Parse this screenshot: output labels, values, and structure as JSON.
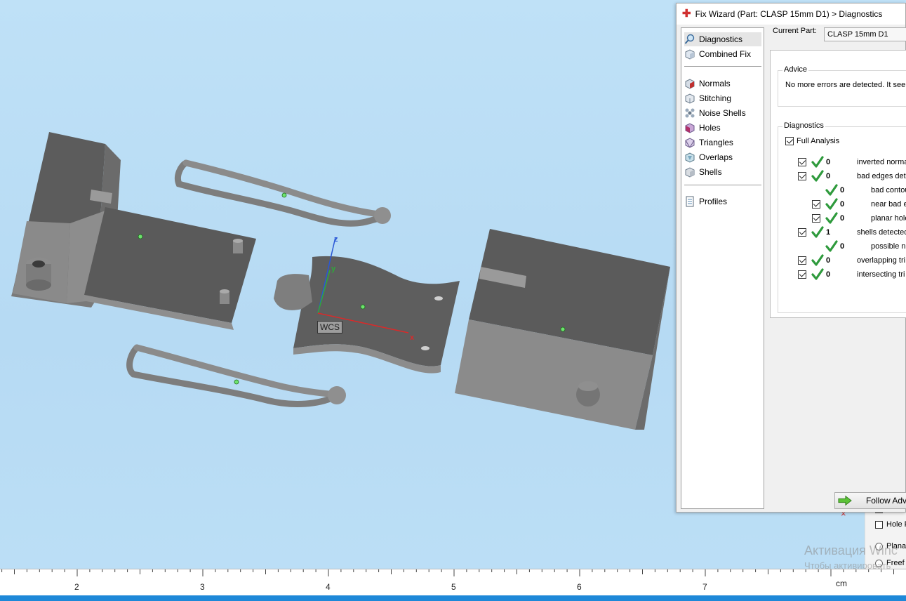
{
  "wizard": {
    "title": "Fix Wizard (Part: CLASP 15mm D1) > Diagnostics",
    "nav": [
      {
        "label": "Diagnostics",
        "icon": "magnifier-icon",
        "selected": true
      },
      {
        "label": "Combined Fix",
        "icon": "cube-fix-icon"
      },
      {
        "label": "Normals",
        "icon": "normals-cube-icon"
      },
      {
        "label": "Stitching",
        "icon": "stitching-icon"
      },
      {
        "label": "Noise Shells",
        "icon": "noise-shells-icon"
      },
      {
        "label": "Holes",
        "icon": "holes-cube-icon"
      },
      {
        "label": "Triangles",
        "icon": "triangles-icon"
      },
      {
        "label": "Overlaps",
        "icon": "overlaps-icon"
      },
      {
        "label": "Shells",
        "icon": "shells-icon"
      },
      {
        "label": "Profiles",
        "icon": "document-icon"
      }
    ],
    "current_part_label": "Current Part:",
    "current_part_value": "CLASP 15mm D1",
    "advice_title": "Advice",
    "advice_text": "No more errors are detected. It see",
    "diagnostics_title": "Diagnostics",
    "full_analysis_label": "Full Analysis",
    "diagnostics": [
      {
        "count": "0",
        "label": "inverted norma",
        "checkbox": true,
        "indent": 0
      },
      {
        "count": "0",
        "label": "bad edges det",
        "checkbox": true,
        "indent": 0
      },
      {
        "count": "0",
        "label": "bad contou",
        "checkbox": false,
        "indent": 1
      },
      {
        "count": "0",
        "label": "near bad e",
        "checkbox": true,
        "indent": 1
      },
      {
        "count": "0",
        "label": "planar hole",
        "checkbox": true,
        "indent": 1
      },
      {
        "count": "1",
        "label": "shells detected",
        "checkbox": true,
        "indent": 0
      },
      {
        "count": "0",
        "label": "possible no",
        "checkbox": false,
        "indent": 1
      },
      {
        "count": "0",
        "label": "overlapping tri",
        "checkbox": true,
        "indent": 0
      },
      {
        "count": "0",
        "label": "intersecting tri",
        "checkbox": true,
        "indent": 0
      }
    ],
    "follow_button_label": "Follow Adv"
  },
  "viewport": {
    "wcs_label": "WCS",
    "axis_x": "x",
    "axis_y": "y",
    "axis_z": "z"
  },
  "ruler": {
    "ticks": [
      "2",
      "3",
      "4",
      "5",
      "6",
      "7"
    ],
    "unit": "cm"
  },
  "background_panel": {
    "hole_label": "Hole F",
    "planar_label": "Plana",
    "freeform_label": "Freef"
  },
  "watermark": {
    "line1": "Активация Winc",
    "line2": "Чтобы активировать"
  },
  "colors": {
    "viewport_bg": "#bfe1f7",
    "part_dark": "#5a5a5a",
    "part_light": "#8a8a8a",
    "ok_green": "#2e9a3c",
    "taskbar": "#1e88d8"
  }
}
